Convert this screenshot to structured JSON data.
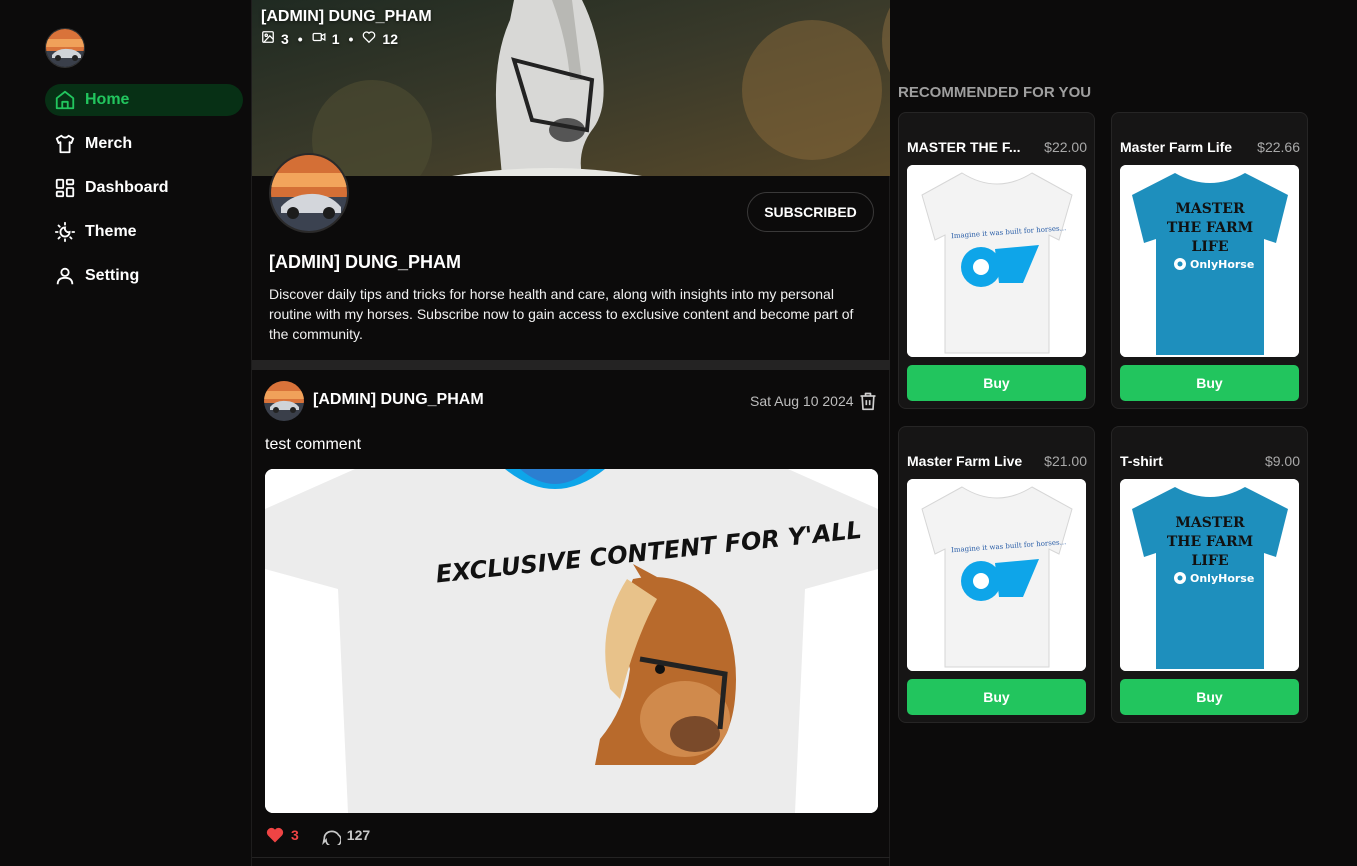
{
  "colors": {
    "accent": "#22c55e",
    "active_bg": "#073015",
    "heart": "#ef4444",
    "background": "#0c0b0b",
    "card_bg": "#161515",
    "shirt_blue": "#1e8fbd"
  },
  "sidebar": {
    "items": [
      {
        "label": "Home",
        "icon": "home-icon",
        "active": true
      },
      {
        "label": "Merch",
        "icon": "shirt-icon",
        "active": false
      },
      {
        "label": "Dashboard",
        "icon": "dashboard-icon",
        "active": false
      },
      {
        "label": "Theme",
        "icon": "theme-icon",
        "active": false
      },
      {
        "label": "Setting",
        "icon": "user-icon",
        "active": false
      }
    ]
  },
  "banner": {
    "title": "[ADMIN] DUNG_PHAM",
    "images": "3",
    "videos": "1",
    "likes": "12"
  },
  "profile": {
    "name": "[ADMIN] DUNG_PHAM",
    "subscribe_label": "SUBSCRIBED",
    "description": "Discover daily tips and tricks for horse health and care, along with insights into my personal routine with my horses. Subscribe now to gain access to exclusive content and become part of the community."
  },
  "post": {
    "author": "[ADMIN] DUNG_PHAM",
    "date": "Sat Aug 10 2024",
    "text": "test comment",
    "image_text": "EXCLUSIVE CONTENT FOR Y'ALL",
    "likes": "3",
    "comments": "127"
  },
  "recommended": {
    "title": "RECOMMENDED FOR YOU",
    "buy_label": "Buy",
    "items": [
      {
        "name": "MASTER THE F...",
        "price": "$22.00",
        "shirt": "white"
      },
      {
        "name": "Master Farm Life",
        "price": "$22.66",
        "shirt": "blue"
      },
      {
        "name": "Master Farm Live",
        "price": "$21.00",
        "shirt": "white"
      },
      {
        "name": "T-shirt",
        "price": "$9.00",
        "shirt": "blue"
      }
    ],
    "white_shirt_text": "Imagine it was built for horses...",
    "blue_shirt_lines": [
      "MASTER",
      "THE FARM",
      "LIFE"
    ],
    "blue_shirt_brand": "OnlyHorse"
  }
}
